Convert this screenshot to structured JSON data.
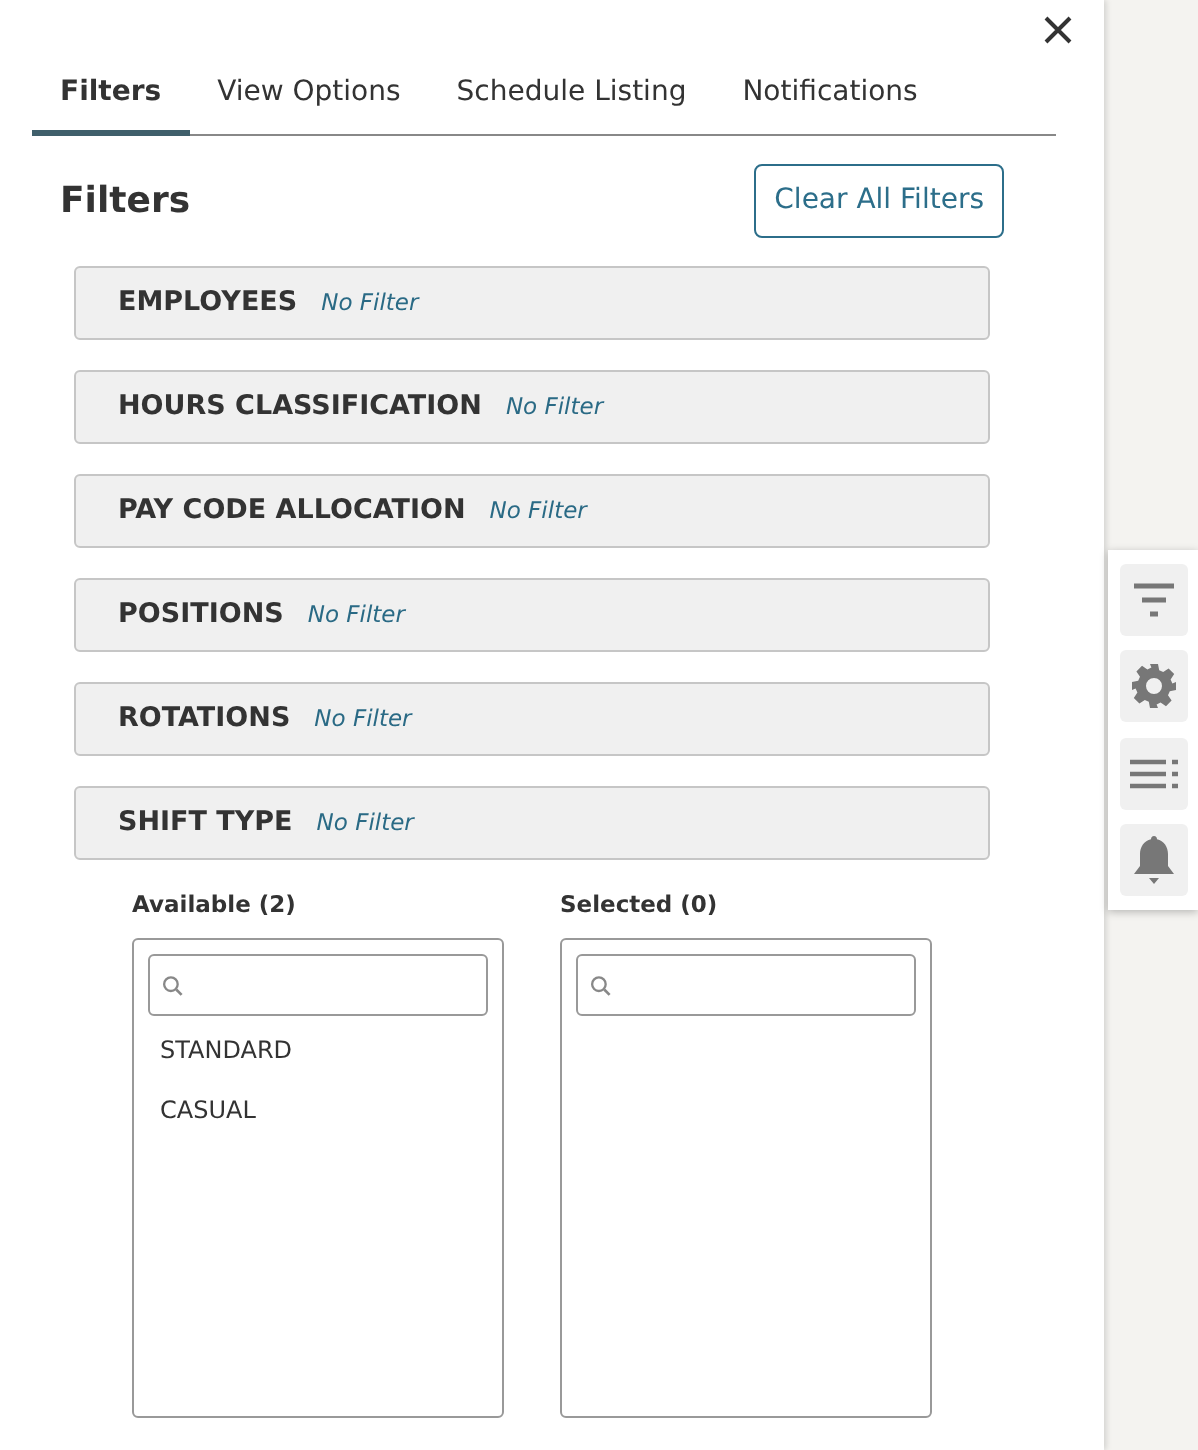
{
  "tabs": [
    {
      "label": "Filters",
      "selected": true
    },
    {
      "label": "View Options",
      "selected": false
    },
    {
      "label": "Schedule Listing",
      "selected": false
    },
    {
      "label": "Notifications",
      "selected": false
    }
  ],
  "heading": "Filters",
  "clear_button": "Clear All Filters",
  "filter_sections": [
    {
      "title": "EMPLOYEES",
      "status": "No Filter"
    },
    {
      "title": "HOURS CLASSIFICATION",
      "status": "No Filter"
    },
    {
      "title": "PAY CODE ALLOCATION",
      "status": "No Filter"
    },
    {
      "title": "POSITIONS",
      "status": "No Filter"
    },
    {
      "title": "ROTATIONS",
      "status": "No Filter"
    },
    {
      "title": "SHIFT TYPE",
      "status": "No Filter",
      "lists": [
        {
          "label": "Available (2)",
          "items": [
            "STANDARD",
            "CASUAL"
          ]
        },
        {
          "label": "Selected (0)"
        }
      ]
    }
  ]
}
